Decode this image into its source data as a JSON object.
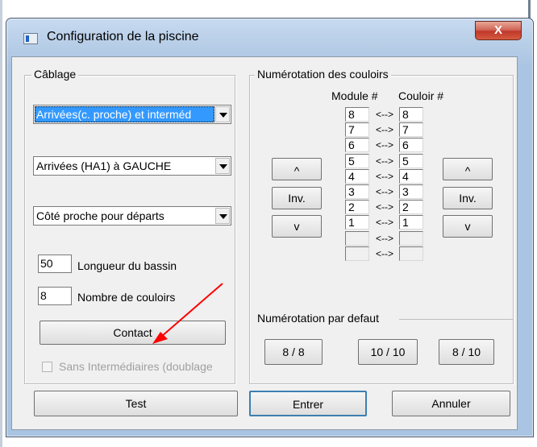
{
  "window": {
    "title": "Configuration de la piscine",
    "close_label": "X"
  },
  "cablage": {
    "legend": "Câblage",
    "select1": "Arrivées(c. proche) et interméd",
    "select2": "Arrivées (HA1) à GAUCHE",
    "select3": "Côté proche pour départs",
    "longueur_value": "50",
    "longueur_label": "Longueur du bassin",
    "couloirs_value": "8",
    "couloirs_label": "Nombre de couloirs",
    "contact_label": "Contact",
    "sans_intermediaires_label": "Sans Intermédiaires (doublage"
  },
  "numerotation": {
    "legend": "Numérotation des couloirs",
    "module_header": "Module #",
    "couloir_header": "Couloir #",
    "separator": "<-->",
    "modules": [
      "8",
      "7",
      "6",
      "5",
      "4",
      "3",
      "2",
      "1",
      "",
      ""
    ],
    "couloirs": [
      "8",
      "7",
      "6",
      "5",
      "4",
      "3",
      "2",
      "1",
      "",
      ""
    ],
    "left_up": "^",
    "left_inv": "Inv.",
    "left_down": "v",
    "right_up": "^",
    "right_inv": "Inv.",
    "right_down": "v"
  },
  "defaut": {
    "legend": "Numérotation par defaut",
    "btn1": "8 / 8",
    "btn2": "10 / 10",
    "btn3": "8 / 10"
  },
  "footer": {
    "test": "Test",
    "entrer": "Entrer",
    "annuler": "Annuler"
  },
  "annotation": {
    "arrow_color": "#ff0000"
  }
}
